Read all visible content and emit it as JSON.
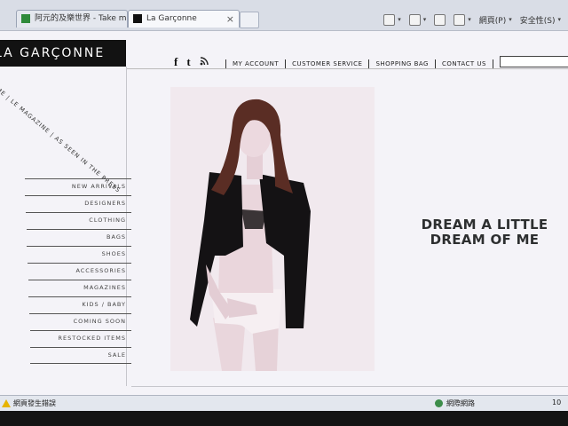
{
  "browser": {
    "tabs": [
      {
        "label": "阿元的及樂世界 - Take me ...",
        "active": false
      },
      {
        "label": "La Garçonne",
        "active": true
      }
    ],
    "tab_close": "×",
    "toolbar": {
      "page_label": "網頁(P)",
      "safety_label": "安全性(S)"
    }
  },
  "site": {
    "logo": "LA GARÇONNE",
    "social": {
      "facebook": "f",
      "twitter": "t",
      "rss": "ʀss"
    },
    "nav": [
      "MY ACCOUNT",
      "CUSTOMER SERVICE",
      "SHOPPING BAG",
      "CONTACT US",
      "SEARCH"
    ],
    "breadcrumb": "HOME | LE MAGAZINE | AS SEEN IN THE PRESS",
    "categories": [
      "NEW ARRIVALS",
      "DESIGNERS",
      "CLOTHING",
      "BAGS",
      "SHOES",
      "ACCESSORIES",
      "MAGAZINES",
      "KIDS / BABY",
      "COMING SOON",
      "RESTOCKED ITEMS",
      "SALE"
    ],
    "tagline": {
      "line1": "DREAM A LITTLE",
      "line2": "DREAM OF ME"
    }
  },
  "statusbar": {
    "message": "網頁發生錯誤",
    "zone": "網際網路",
    "zoom": "10"
  },
  "colors": {
    "logo_bg": "#121212",
    "page_bg": "#f4f3f8",
    "tagline": "#2d2f30"
  }
}
